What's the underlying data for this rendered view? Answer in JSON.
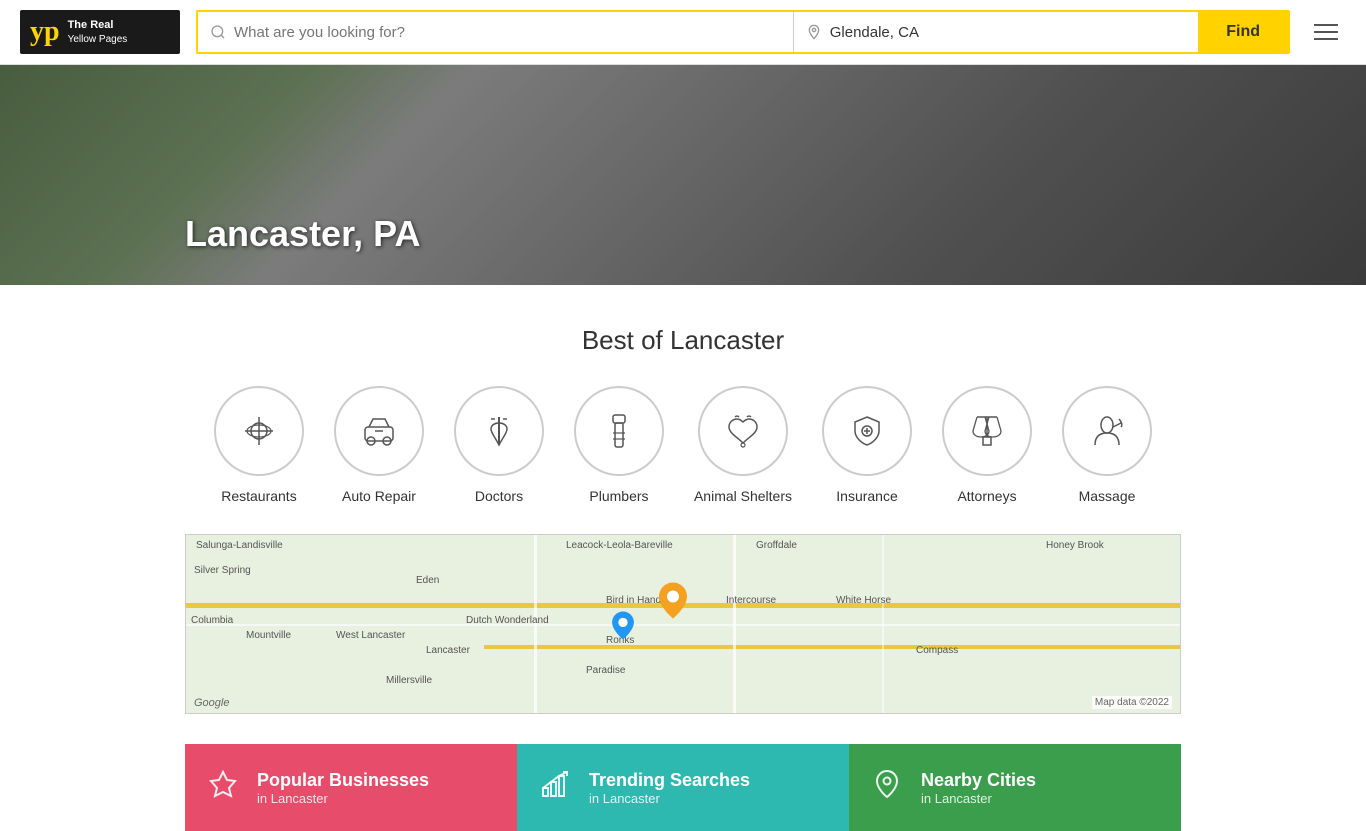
{
  "header": {
    "logo_yp": "yp",
    "logo_line1": "The Real",
    "logo_line2": "Yellow Pages",
    "search_placeholder": "What are you looking for?",
    "location_value": "Glendale, CA",
    "find_button": "Find"
  },
  "hero": {
    "city_title": "Lancaster, PA"
  },
  "best_of": {
    "title": "Best of Lancaster",
    "categories": [
      {
        "id": "restaurants",
        "label": "Restaurants"
      },
      {
        "id": "auto-repair",
        "label": "Auto Repair"
      },
      {
        "id": "doctors",
        "label": "Doctors"
      },
      {
        "id": "plumbers",
        "label": "Plumbers"
      },
      {
        "id": "animal-shelters",
        "label": "Animal Shelters"
      },
      {
        "id": "insurance",
        "label": "Insurance"
      },
      {
        "id": "attorneys",
        "label": "Attorneys"
      },
      {
        "id": "massage",
        "label": "Massage"
      }
    ]
  },
  "map": {
    "labels": [
      "Salunga-Landisville",
      "Silver Spring",
      "Columbia",
      "Mountville",
      "West Lancaster",
      "Lancaster",
      "Eden",
      "Dutch Wonderland",
      "Bird in Hand",
      "Ronks",
      "Paradise",
      "Millersville",
      "Intercourse",
      "White Horse",
      "Compass",
      "Honey Brook",
      "Groffdale",
      "Leacock-Leola-Bareville"
    ],
    "attribution": "Map data ©2022"
  },
  "bottom_cards": [
    {
      "id": "popular",
      "icon": "★",
      "title": "Popular Businesses",
      "subtitle": "in Lancaster",
      "color": "card-pink"
    },
    {
      "id": "trending",
      "icon": "📈",
      "title": "Trending Searches",
      "subtitle": "in Lancaster",
      "color": "card-teal"
    },
    {
      "id": "nearby",
      "icon": "📍",
      "title": "Nearby Cities",
      "subtitle": "in Lancaster",
      "color": "card-green"
    }
  ]
}
